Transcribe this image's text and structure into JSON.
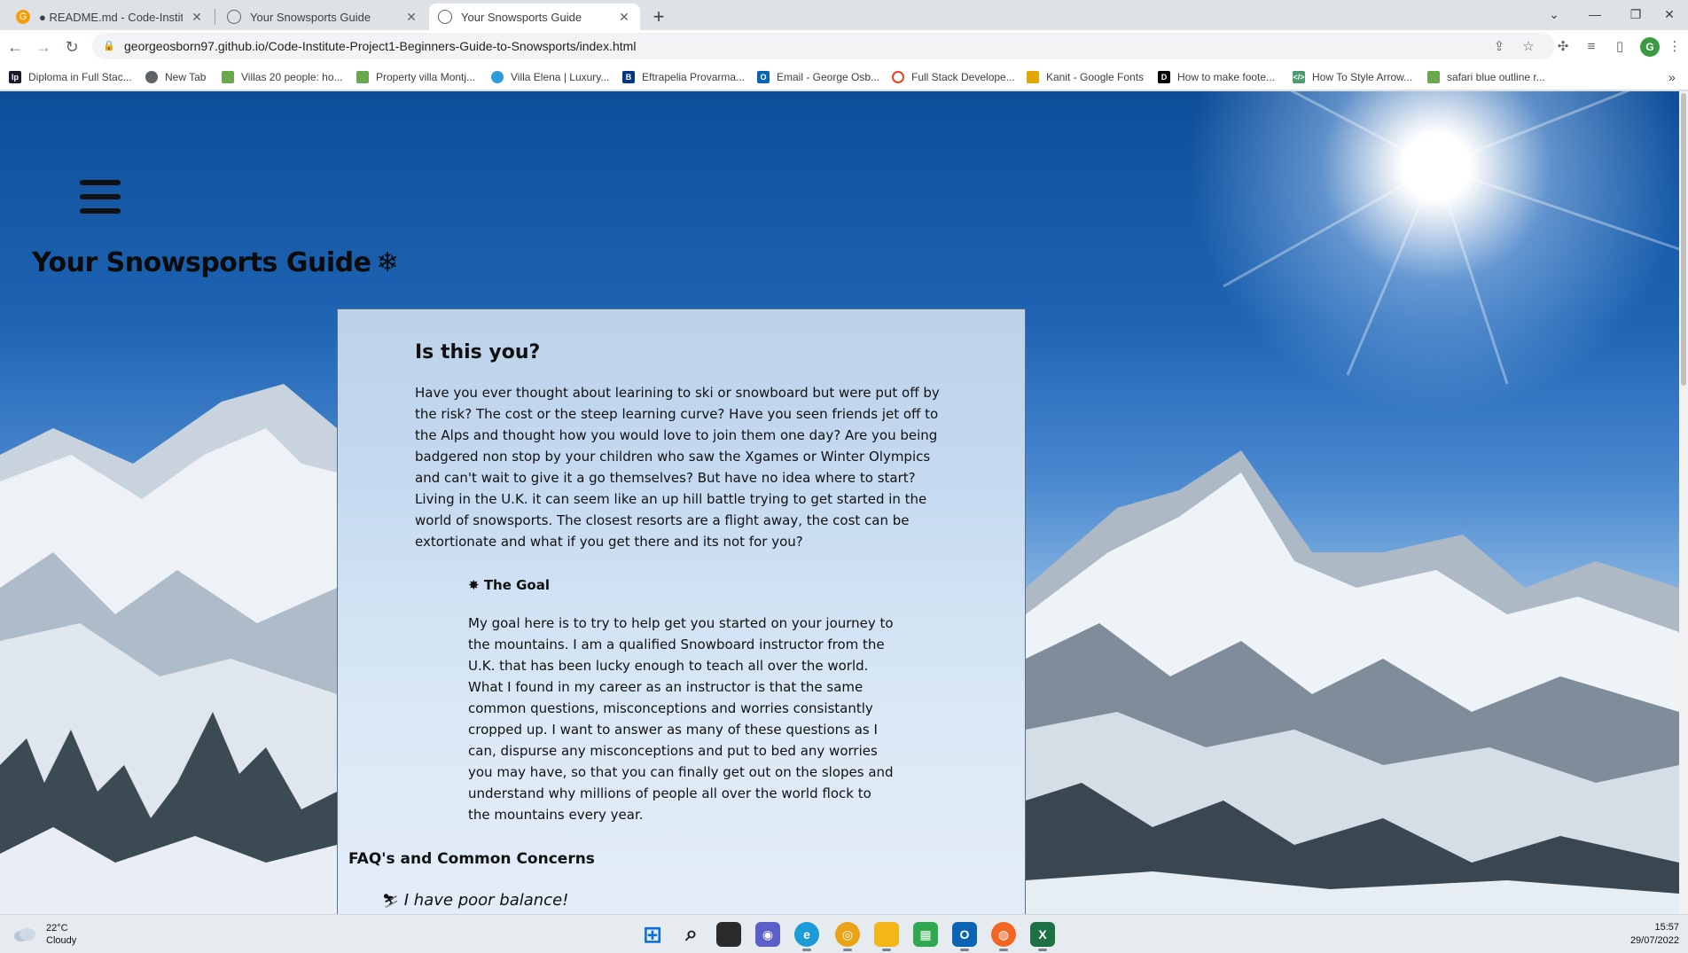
{
  "browser": {
    "tabs": [
      {
        "title": "● README.md - Code-Institute-P",
        "icon": "gitpod-icon",
        "active": false
      },
      {
        "title": "Your Snowsports Guide",
        "icon": "globe-icon",
        "active": false
      },
      {
        "title": "Your Snowsports Guide",
        "icon": "globe-icon",
        "active": true
      }
    ],
    "url": "georgeosborn97.github.io/Code-Institute-Project1-Beginners-Guide-to-Snowsports/index.html",
    "profile_initial": "G",
    "bookmarks": [
      {
        "label": "Diploma in Full Stac...",
        "icon": "lp-icon",
        "color": "#1a1a2e"
      },
      {
        "label": "New Tab",
        "icon": "globe-icon",
        "color": "#5f6368"
      },
      {
        "label": "Villas 20 people: ho...",
        "icon": "villa-icon",
        "color": "#6aa84f"
      },
      {
        "label": "Property villa Montj...",
        "icon": "villa-icon",
        "color": "#6aa84f"
      },
      {
        "label": "Villa Elena | Luxury...",
        "icon": "villa-elena-icon",
        "color": "#2d9cdb"
      },
      {
        "label": "Eftrapelia Provarma...",
        "icon": "booking-icon",
        "color": "#003580"
      },
      {
        "label": "Email - George Osb...",
        "icon": "outlook-icon",
        "color": "#0a64b4"
      },
      {
        "label": "Full Stack Develope...",
        "icon": "ring-icon",
        "color": "#e8431f"
      },
      {
        "label": "Kanit - Google Fonts",
        "icon": "google-fonts-icon",
        "color": "#e0a800"
      },
      {
        "label": "How to make foote...",
        "icon": "dev-icon",
        "color": "#000000"
      },
      {
        "label": "How To Style Arrow...",
        "icon": "code-icon",
        "color": "#4a9d6f"
      },
      {
        "label": "safari blue outline r...",
        "icon": "sparkle-icon",
        "color": "#6aa84f"
      }
    ]
  },
  "page": {
    "site_title": "Your Snowsports Guide",
    "title_icon": "❄",
    "card": {
      "heading": "Is this you?",
      "intro": "Have you ever thought about learining to ski or snowboard but were put off by the risk? The cost or the steep learning curve? Have you seen friends jet off to the Alps and thought how you would love to join them one day? Are you being badgered non stop by your children who saw the Xgames or Winter Olympics and can't wait to give it a go themselves? But have no idea where to start? Living in the U.K. it can seem like an up hill battle trying to get started in the world of snowsports. The closest resorts are a flight away, the cost can be extortionate and what if you get there and its not for you?",
      "goal_icon": "✸",
      "goal_heading": "The Goal",
      "goal_text": "My goal here is to try to help get you started on your journey to the mountains. I am a qualified Snowboard instructor from the U.K. that has been lucky enough to teach all over the world. What I found in my career as an instructor is that the same common questions, misconceptions and worries consistantly cropped up. I want to answer as many of these questions as I can, dispurse any misconceptions and put to bed any worries you may have, so that you can finally get out on the slopes and understand why millions of people all over the world flock to the mountains every year.",
      "faq_heading": "FAQ's and Common Concerns",
      "faq_item_icon": "⛷",
      "faq_item": "I have poor balance!"
    }
  },
  "taskbar": {
    "weather_temp": "22°C",
    "weather_desc": "Cloudy",
    "time": "15:57",
    "date": "29/07/2022",
    "apps": [
      {
        "name": "start-icon",
        "color": "#0a6fd8",
        "glyph": "⊞"
      },
      {
        "name": "search-icon",
        "color": "#e6ebf0",
        "glyph": "⌕"
      },
      {
        "name": "file-manager-icon",
        "color": "#2b2b2b",
        "glyph": "▮"
      },
      {
        "name": "teams-icon",
        "color": "#5b5fc7",
        "glyph": "◉"
      },
      {
        "name": "edge-icon",
        "color": "#1c9bd8",
        "glyph": "e"
      },
      {
        "name": "chrome-icon",
        "color": "#e8a317",
        "glyph": "◎"
      },
      {
        "name": "explorer-icon",
        "color": "#f2b619",
        "glyph": "▬"
      },
      {
        "name": "numbers-icon",
        "color": "#2fa84f",
        "glyph": "▦"
      },
      {
        "name": "outlook-icon",
        "color": "#0a64b4",
        "glyph": "O"
      },
      {
        "name": "podcast-icon",
        "color": "#f26522",
        "glyph": "◍"
      },
      {
        "name": "excel-icon",
        "color": "#1d7044",
        "glyph": "X"
      }
    ]
  }
}
